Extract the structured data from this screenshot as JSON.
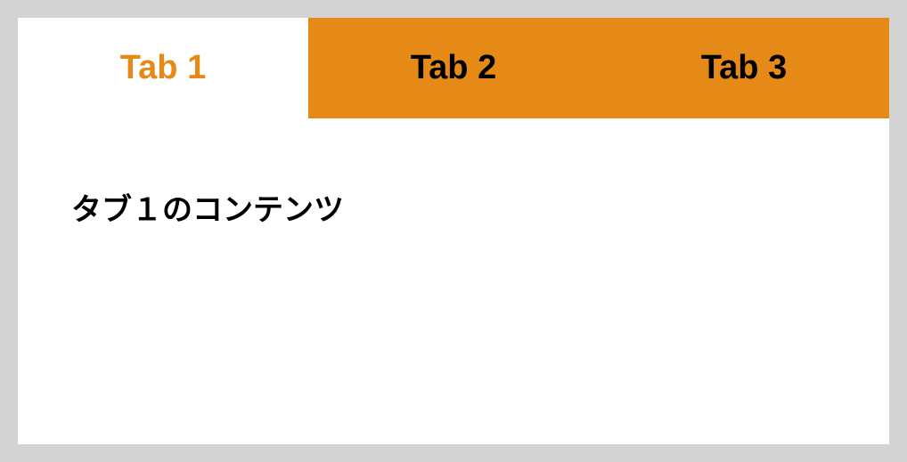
{
  "tabs": [
    {
      "label": "Tab 1",
      "active": true
    },
    {
      "label": "Tab 2",
      "active": false
    },
    {
      "label": "Tab 3",
      "active": false
    }
  ],
  "content": {
    "text": "タブ１のコンテンツ"
  },
  "colors": {
    "accent": "#e68a17",
    "background": "#d3d3d3",
    "panel": "#ffffff"
  }
}
